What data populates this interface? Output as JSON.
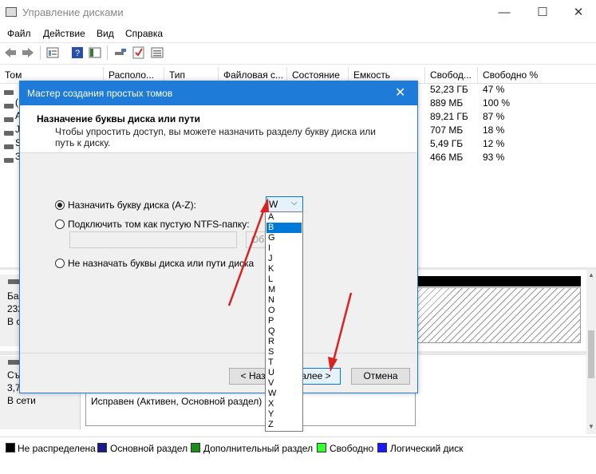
{
  "window": {
    "title": "Управление дисками",
    "controls": {
      "minimize": "—",
      "maximize": "☐",
      "close": "✕"
    }
  },
  "menu": [
    "Файл",
    "Действие",
    "Вид",
    "Справка"
  ],
  "toolbar_icons": [
    "back-icon",
    "forward-icon",
    "properties-icon",
    "help-icon",
    "panel-icon",
    "connect-icon",
    "check-icon",
    "list-icon"
  ],
  "table": {
    "columns": [
      "Том",
      "Располо...",
      "Тип",
      "Файловая с...",
      "Состояние",
      "Емкость",
      "Свобод...",
      "Свободно %"
    ],
    "free": [
      "52,23 ГБ",
      "889 МБ",
      "89,21 ГБ",
      "707 МБ",
      "5,49 ГБ",
      "466 МБ"
    ],
    "free_pct": [
      "47 %",
      "100 %",
      "87 %",
      "18 %",
      "12 %",
      "93 %"
    ],
    "vol_fragments": [
      "",
      "(",
      "А",
      "J",
      "S",
      "З"
    ]
  },
  "lower": {
    "disk0_lines": [
      "Ба",
      "232",
      "В се"
    ],
    "disk1_lines": [
      "Съ",
      "3,7",
      "В сети"
    ],
    "partition_status": "Исправен (Активен, Основной раздел)"
  },
  "dialog": {
    "title": "Мастер создания простых томов",
    "heading": "Назначение буквы диска или пути",
    "subtitle_line1": "Чтобы упростить доступ, вы можете назначить разделу букву диска или",
    "subtitle_line2": "путь к диску.",
    "option_assign": "Назначить букву диска (A-Z):",
    "option_mount": "Подключить том как пустую NTFS-папку:",
    "option_none": "Не назначать буквы диска или пути диска",
    "selected_letter": "W",
    "browse_fragment": "Об",
    "back_button": "< Назад",
    "next_button": "алее >",
    "cancel_button": "Отмена"
  },
  "dropdown_options": [
    "A",
    "B",
    "G",
    "I",
    "J",
    "K",
    "L",
    "M",
    "N",
    "O",
    "P",
    "Q",
    "R",
    "S",
    "T",
    "U",
    "V",
    "W",
    "X",
    "Y",
    "Z"
  ],
  "dropdown_highlighted": "B",
  "legend": [
    {
      "label": "Не распределена",
      "color": "#000000"
    },
    {
      "label": "Основной раздел",
      "color": "#1a1a8c"
    },
    {
      "label": "Дополнительный раздел",
      "color": "#1c8c1c"
    },
    {
      "label": "Свободно",
      "color": "#33ff33"
    },
    {
      "label": "Логический диск",
      "color": "#1a1aff"
    }
  ],
  "colors": {
    "accent": "#1e7bd7",
    "arrow": "#d92323",
    "selection": "#0078d7"
  }
}
